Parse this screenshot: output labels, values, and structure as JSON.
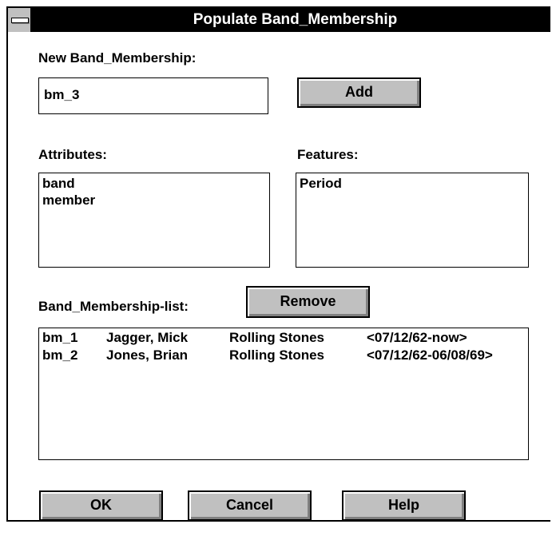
{
  "window": {
    "title": "Populate Band_Membership"
  },
  "new_entry": {
    "label": "New Band_Membership:",
    "value": "bm_3",
    "add_label": "Add"
  },
  "attributes": {
    "label": "Attributes:",
    "items": [
      "band",
      "member"
    ]
  },
  "features": {
    "label": "Features:",
    "items": [
      "Period"
    ]
  },
  "list": {
    "label": "Band_Membership-list:",
    "remove_label": "Remove",
    "rows": [
      {
        "id": "bm_1",
        "member": "Jagger, Mick",
        "band": "Rolling Stones",
        "period": "<07/12/62-now>"
      },
      {
        "id": "bm_2",
        "member": "Jones, Brian",
        "band": "Rolling Stones",
        "period": "<07/12/62-06/08/69>"
      }
    ]
  },
  "buttons": {
    "ok": "OK",
    "cancel": "Cancel",
    "help": "Help"
  },
  "icons": {
    "system_menu": "system-menu-icon"
  }
}
